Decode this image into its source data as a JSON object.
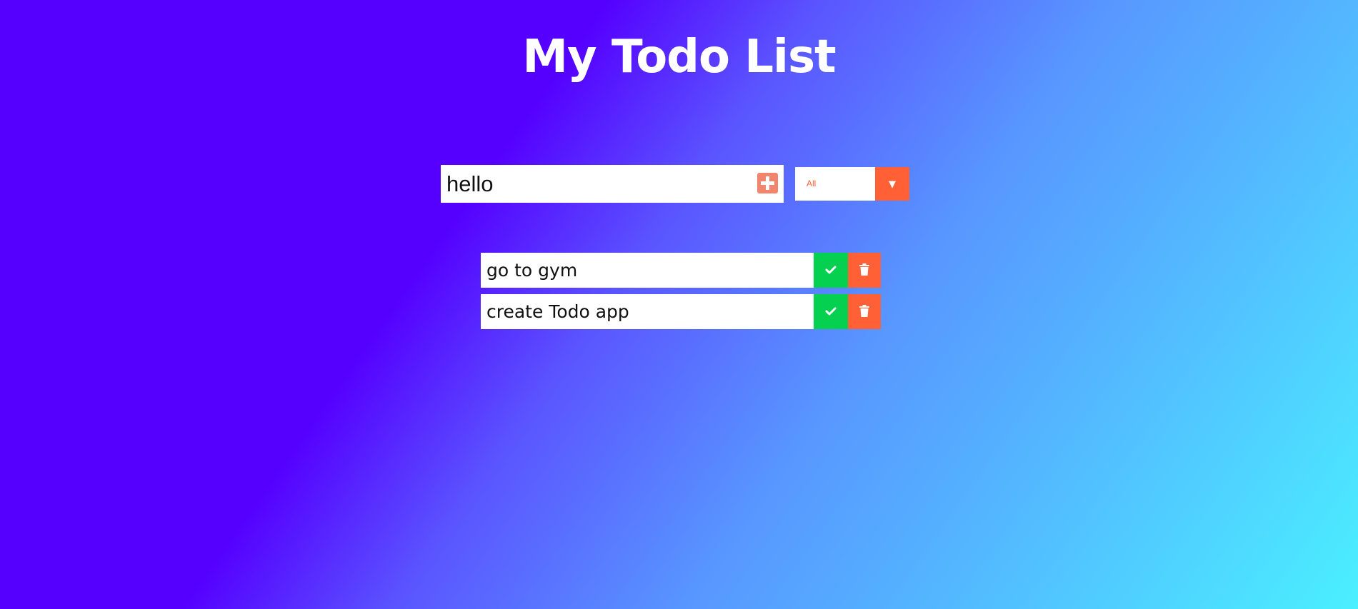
{
  "app": {
    "title": "My Todo List"
  },
  "form": {
    "input_value": "hello",
    "add_icon": "plus-square-icon",
    "filter": {
      "selected": "All",
      "arrow_icon": "caret-down-icon"
    }
  },
  "todos": [
    {
      "text": "go to gym",
      "complete_icon": "check-icon",
      "delete_icon": "trash-icon"
    },
    {
      "text": "create Todo app",
      "complete_icon": "check-icon",
      "delete_icon": "trash-icon"
    }
  ],
  "colors": {
    "background_start": "#5500ff",
    "background_end": "#4af0ff",
    "accent": "#ff6035",
    "add_button": "#f2856d",
    "complete": "#06d04f",
    "surface": "#ffffff"
  }
}
